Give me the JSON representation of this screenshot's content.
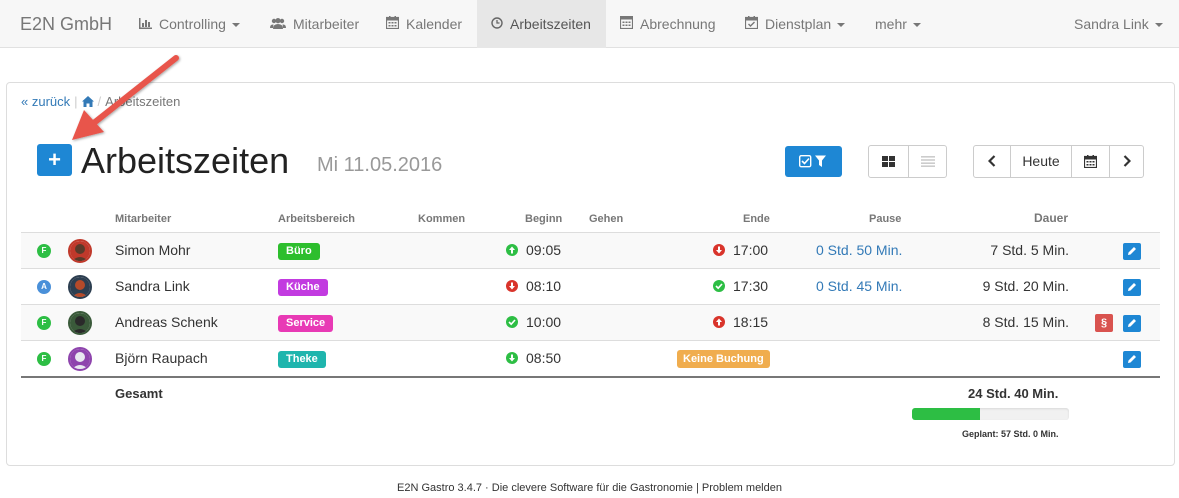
{
  "navbar": {
    "brand": "E2N GmbH",
    "items": [
      {
        "label": "Controlling",
        "icon": "bar-chart-icon",
        "dropdown": true
      },
      {
        "label": "Mitarbeiter",
        "icon": "users-icon",
        "dropdown": false
      },
      {
        "label": "Kalender",
        "icon": "calendar-icon",
        "dropdown": false
      },
      {
        "label": "Arbeitszeiten",
        "icon": "clock-icon",
        "dropdown": false,
        "active": true
      },
      {
        "label": "Abrechnung",
        "icon": "calculator-icon",
        "dropdown": false
      },
      {
        "label": "Dienstplan",
        "icon": "calendar-check-icon",
        "dropdown": true
      },
      {
        "label": "mehr",
        "dropdown": true
      }
    ],
    "user": "Sandra Link"
  },
  "breadcrumb": {
    "back": "« zurück",
    "current": "Arbeitszeiten"
  },
  "page": {
    "title": "Arbeitszeiten",
    "date": "Mi 11.05.2016",
    "add_label": "+"
  },
  "toolbar": {
    "today": "Heute"
  },
  "table": {
    "headers": {
      "mitarbeiter": "Mitarbeiter",
      "bereich": "Arbeitsbereich",
      "kommen": "Kommen",
      "beginn": "Beginn",
      "gehen": "Gehen",
      "ende": "Ende",
      "pause": "Pause",
      "dauer": "Dauer"
    },
    "rows": [
      {
        "status": "F",
        "status_color": "#2dbe44",
        "name": "Simon Mohr",
        "bereich": "Büro",
        "bereich_color": "#2dbe2d",
        "beginn": "09:05",
        "beginn_icon": "up",
        "beginn_color": "#2dbe44",
        "ende": "17:00",
        "ende_icon": "down",
        "ende_color": "#d9342b",
        "pause": "0 Std. 50 Min.",
        "dauer": "7 Std. 5 Min.",
        "keine": "",
        "para": false
      },
      {
        "status": "A",
        "status_color": "#4a90d9",
        "name": "Sandra Link",
        "bereich": "Küche",
        "bereich_color": "#c23be0",
        "beginn": "08:10",
        "beginn_icon": "down",
        "beginn_color": "#d9342b",
        "ende": "17:30",
        "ende_icon": "check",
        "ende_color": "#2dbe44",
        "pause": "0 Std. 45 Min.",
        "dauer": "9 Std. 20 Min.",
        "keine": "",
        "para": false
      },
      {
        "status": "F",
        "status_color": "#2dbe44",
        "name": "Andreas Schenk",
        "bereich": "Service",
        "bereich_color": "#e83ab5",
        "beginn": "10:00",
        "beginn_icon": "check",
        "beginn_color": "#2dbe44",
        "ende": "18:15",
        "ende_icon": "up",
        "ende_color": "#d9342b",
        "pause": "",
        "dauer": "8 Std. 15 Min.",
        "keine": "",
        "para": true
      },
      {
        "status": "F",
        "status_color": "#2dbe44",
        "name": "Björn Raupach",
        "bereich": "Theke",
        "bereich_color": "#1fb5ad",
        "beginn": "08:50",
        "beginn_icon": "down",
        "beginn_color": "#2dbe44",
        "ende": "",
        "ende_icon": "",
        "ende_color": "",
        "pause": "",
        "dauer": "",
        "keine": "Keine Buchung",
        "para": false
      }
    ],
    "para_label": "§"
  },
  "summary": {
    "label": "Gesamt",
    "total": "24 Std. 40 Min.",
    "planned": "Geplant: 57 Std. 0 Min.",
    "progress_fraction": 0.43
  },
  "footer": "E2N Gastro 3.4.7 · Die clevere Software für die Gastronomie | Problem melden"
}
